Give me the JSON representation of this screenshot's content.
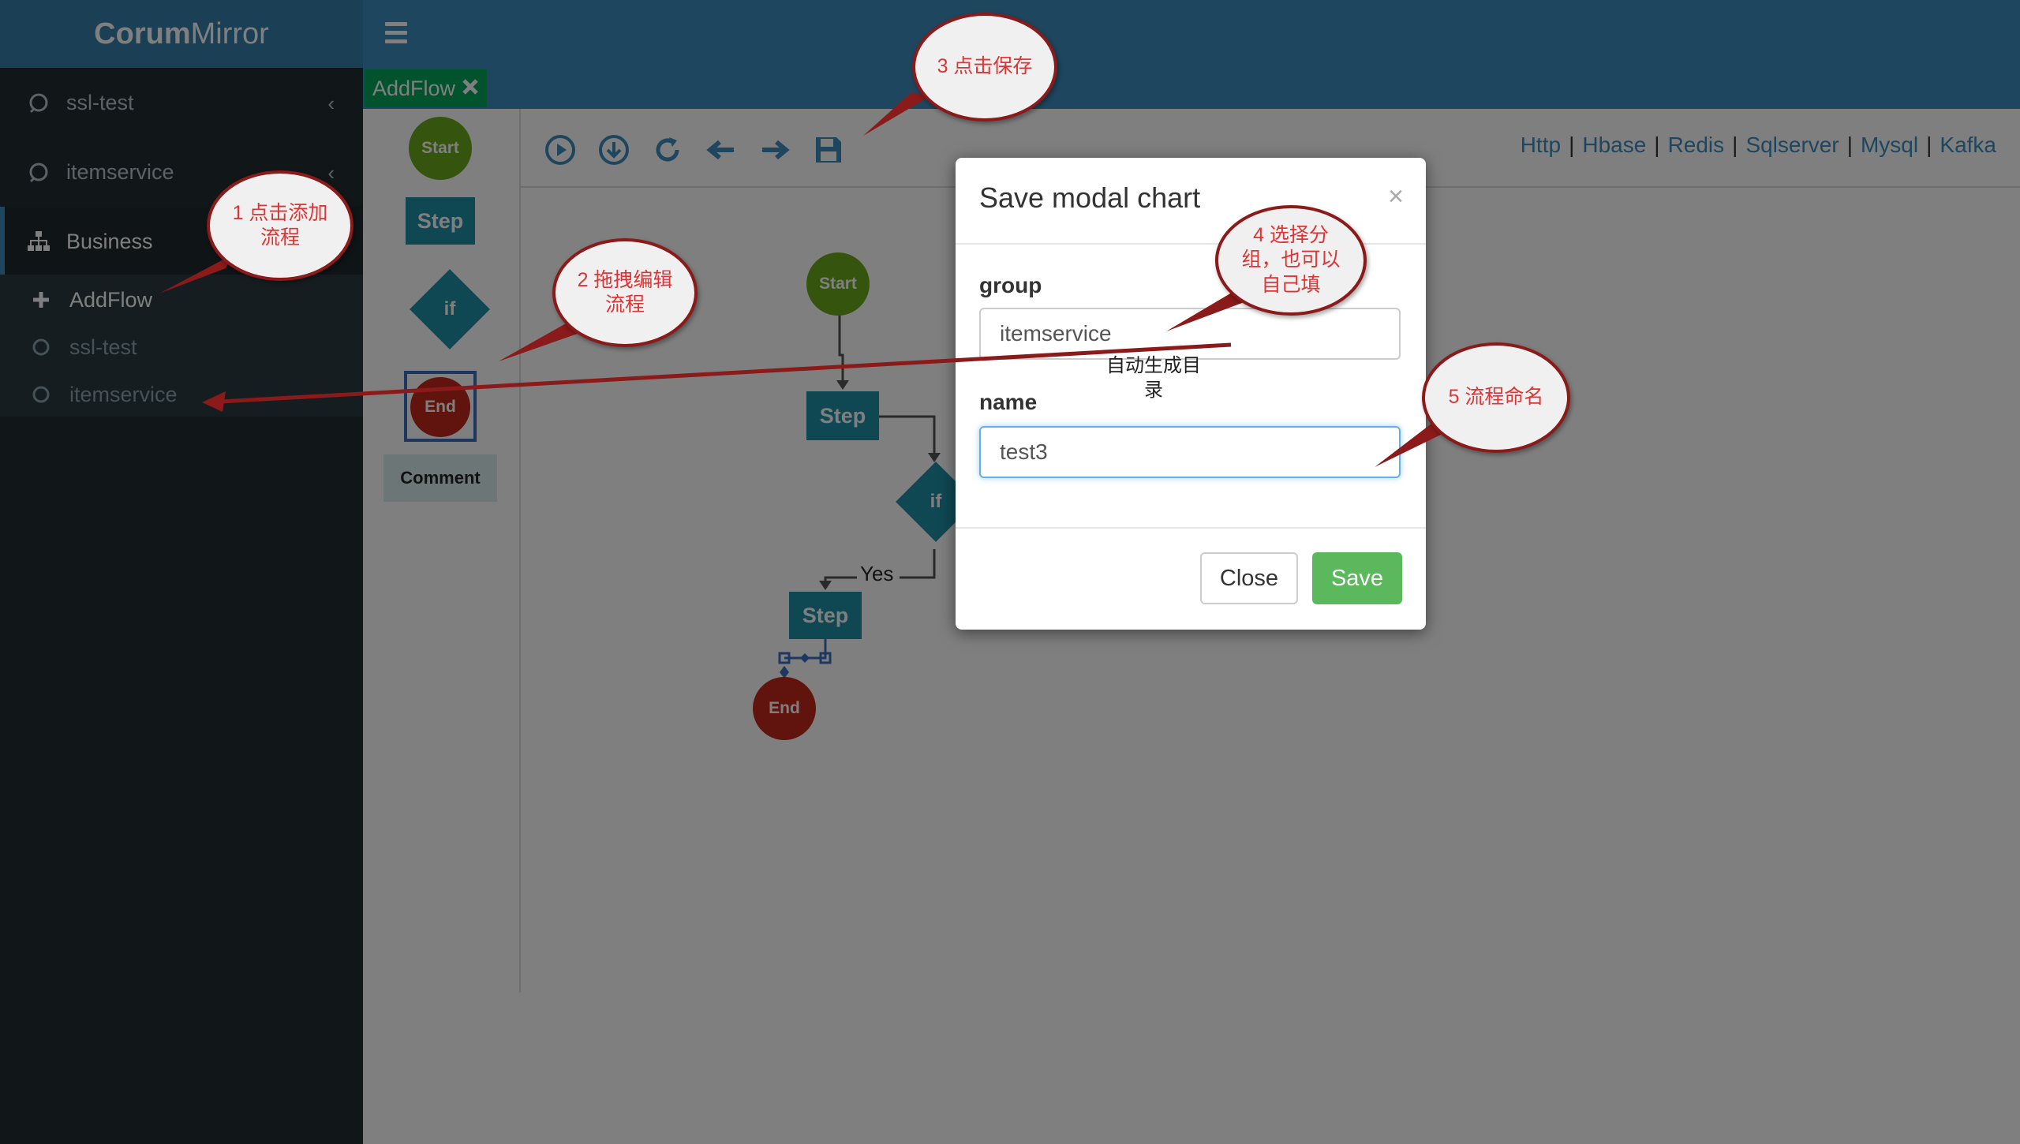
{
  "app": {
    "logo_bold": "Corum",
    "logo_light": "Mirror"
  },
  "sidebar": {
    "items": [
      {
        "label": "ssl-test",
        "icon": "circle-arrow-icon"
      },
      {
        "label": "itemservice",
        "icon": "circle-arrow-icon"
      },
      {
        "label": "Business",
        "icon": "sitemap-icon"
      }
    ],
    "submenu": [
      {
        "label": "AddFlow",
        "icon": "plus-icon"
      },
      {
        "label": "ssl-test",
        "icon": "circle-icon"
      },
      {
        "label": "itemservice",
        "icon": "circle-icon"
      }
    ]
  },
  "tabs": [
    {
      "label": "AddFlow"
    }
  ],
  "palette": {
    "start": "Start",
    "step": "Step",
    "if": "if",
    "end": "End",
    "comment": "Comment"
  },
  "toolbar": {
    "icons": [
      "play-icon",
      "download-icon",
      "refresh-icon",
      "arrow-left-icon",
      "arrow-right-icon",
      "save-icon"
    ],
    "db_links": [
      "Http",
      "Hbase",
      "Redis",
      "Sqlserver",
      "Mysql",
      "Kafka"
    ]
  },
  "canvas": {
    "start": "Start",
    "step1": "Step",
    "if": "if",
    "yes": "Yes",
    "step2": "Step",
    "end": "End"
  },
  "modal": {
    "title": "Save modal chart",
    "close_x": "×",
    "group_label": "group",
    "group_value": "itemservice",
    "name_label": "name",
    "name_value": "test3",
    "close_button": "Close",
    "save_button": "Save"
  },
  "annotations": {
    "c1": "1 点击添加流程",
    "c2": "2 拖拽编辑流程",
    "c3": "3 点击保存",
    "c4": "4 选择分组，也可以自己填",
    "c5": "5 流程命名",
    "note": "自动生成目录"
  },
  "colors": {
    "header": "#3c8dbc",
    "sidebar": "#222d32",
    "save": "#5cb85c",
    "tab": "#00a65a",
    "callout_border": "#8b1a1a",
    "callout_text": "#e03434"
  }
}
